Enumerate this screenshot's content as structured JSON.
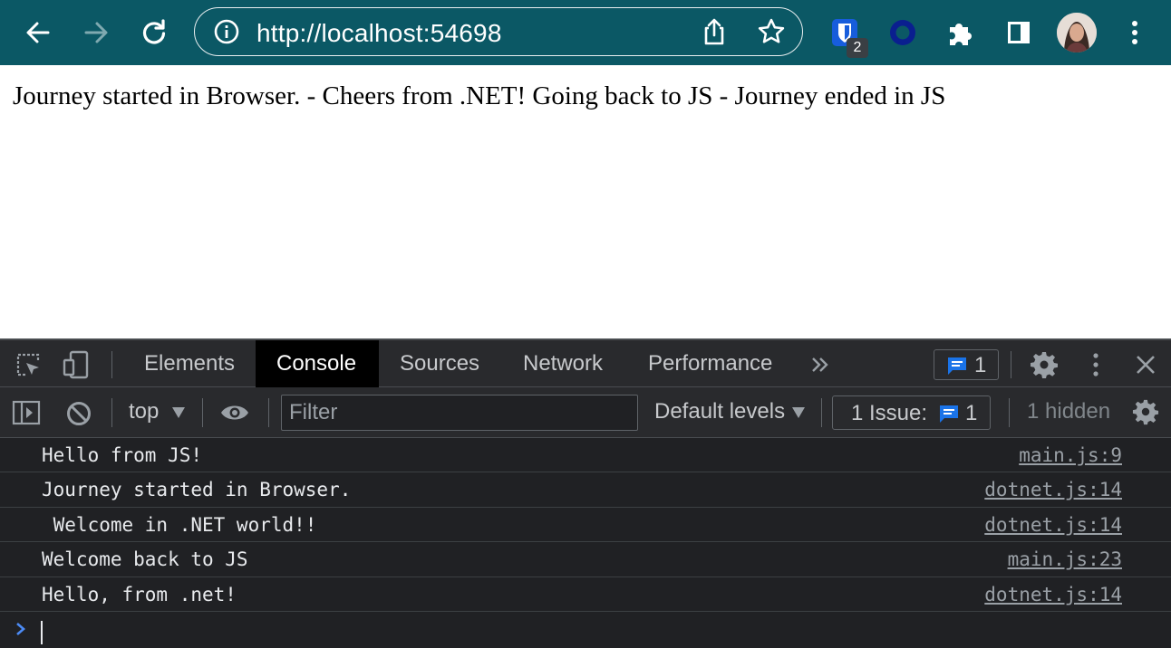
{
  "browser": {
    "url": "http://localhost:54698",
    "extension_badge": "2"
  },
  "page": {
    "text": "Journey started in Browser. - Cheers from .NET! Going back to JS - Journey ended in JS"
  },
  "devtools": {
    "tabs": [
      {
        "label": "Elements"
      },
      {
        "label": "Console"
      },
      {
        "label": "Sources"
      },
      {
        "label": "Network"
      },
      {
        "label": "Performance"
      }
    ],
    "active_tab": "Console",
    "issues_count": "1",
    "context": "top",
    "filter_placeholder": "Filter",
    "levels": "Default levels",
    "issue_label": "1 Issue:",
    "issue_count": "1",
    "hidden": "1 hidden",
    "console": [
      {
        "message": "Hello from JS!",
        "source": "main.js:9"
      },
      {
        "message": "Journey started in Browser.",
        "source": "dotnet.js:14"
      },
      {
        "message": " Welcome in .NET world!!",
        "source": "dotnet.js:14"
      },
      {
        "message": "Welcome back to JS",
        "source": "main.js:23"
      },
      {
        "message": "Hello, from .net!",
        "source": "dotnet.js:14"
      }
    ]
  },
  "colors": {
    "toolbar": "#0b5865",
    "devtools_bg": "#202124",
    "accent_blue": "#1a73e8"
  }
}
